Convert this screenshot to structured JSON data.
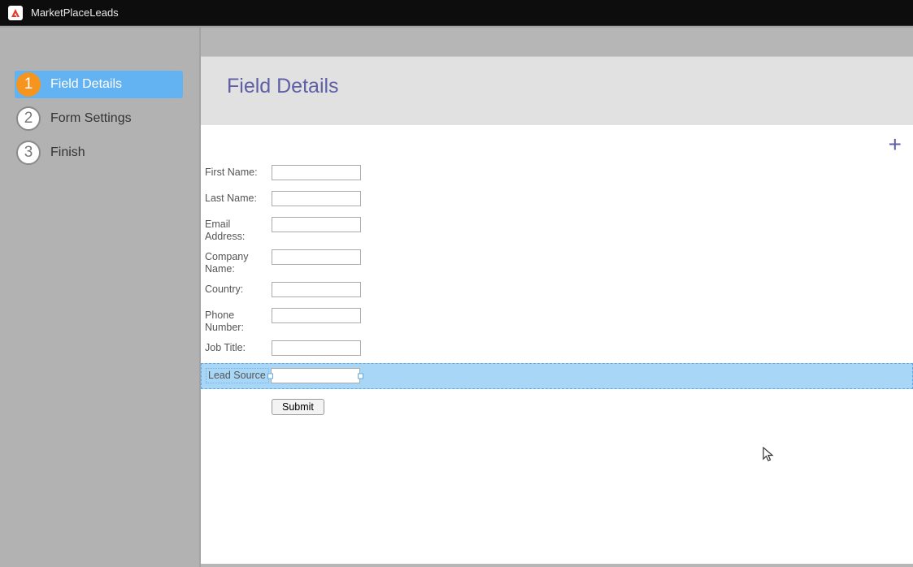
{
  "app": {
    "title": "MarketPlaceLeads"
  },
  "sidebar": {
    "steps": [
      {
        "num": "1",
        "label": "Field Details",
        "active": true
      },
      {
        "num": "2",
        "label": "Form Settings",
        "active": false
      },
      {
        "num": "3",
        "label": "Finish",
        "active": false
      }
    ]
  },
  "section": {
    "title": "Field Details"
  },
  "form": {
    "fields": [
      {
        "label": "First Name:",
        "value": "",
        "selected": false
      },
      {
        "label": "Last Name:",
        "value": "",
        "selected": false
      },
      {
        "label": "Email Address:",
        "value": "",
        "selected": false
      },
      {
        "label": "Company Name:",
        "value": "",
        "selected": false
      },
      {
        "label": "Country:",
        "value": "",
        "selected": false
      },
      {
        "label": "Phone Number:",
        "value": "",
        "selected": false
      },
      {
        "label": "Job Title:",
        "value": "",
        "selected": false
      },
      {
        "label": "Lead Source",
        "value": "",
        "selected": true
      }
    ],
    "submit_label": "Submit"
  },
  "icons": {
    "add": "+"
  }
}
